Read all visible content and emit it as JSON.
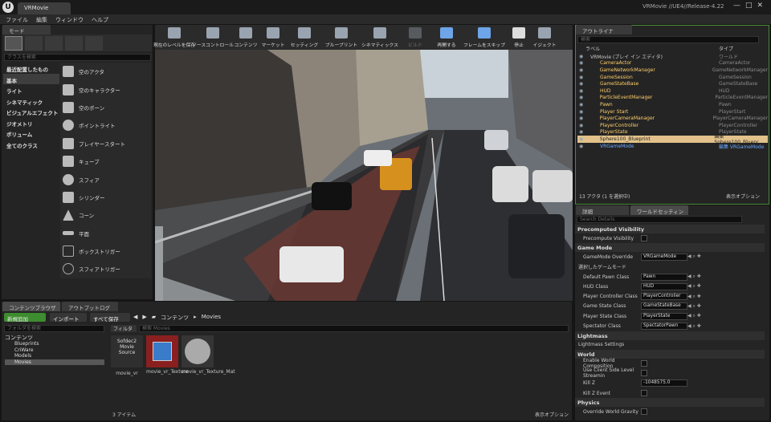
{
  "app": {
    "doc_tab": "VRMovie",
    "project": "VRMovie //UE4//Release-4.22",
    "window_buttons": [
      "—",
      "□",
      "✕"
    ]
  },
  "menu": [
    "ファイル",
    "編集",
    "ウィンドウ",
    "ヘルプ"
  ],
  "modes": {
    "tab": "モード",
    "search_placeholder": "クラスを検索",
    "categories": [
      "最近配置したもの",
      "基本",
      "ライト",
      "シネマティック",
      "ビジュアルエフェクト",
      "ジオメトリ",
      "ボリューム",
      "全てのクラス"
    ],
    "selected_category": 1,
    "items": [
      "空のアクタ",
      "空のキャラクター",
      "空のポーン",
      "ポイントライト",
      "プレイヤースタート",
      "キューブ",
      "スフィア",
      "シリンダー",
      "コーン",
      "平面",
      "ボックストリガー",
      "スフィアトリガー"
    ]
  },
  "toolbar": [
    "現在のレベルを保存",
    "ソースコントロール",
    "コンテンツ",
    "マーケット",
    "セッティング",
    "ブループリント",
    "シネマティックス",
    "ビルド",
    "再開する",
    "フレームをスキップ",
    "停止",
    "イジェクト"
  ],
  "outliner": {
    "tab": "アウトライナ",
    "search_placeholder": "検索",
    "col_label": "ラベル",
    "col_type": "タイプ",
    "rows": [
      {
        "name": "VRMovie (プレイ イン エディタ)",
        "type": "ワールド"
      },
      {
        "name": "CameraActor",
        "type": "CameraActor"
      },
      {
        "name": "GameNetworkManager",
        "type": "GameNetworkManager"
      },
      {
        "name": "GameSession",
        "type": "GameSession"
      },
      {
        "name": "GameStateBase",
        "type": "GameStateBase"
      },
      {
        "name": "HUD",
        "type": "HUD"
      },
      {
        "name": "ParticleEventManager",
        "type": "ParticleEventManager"
      },
      {
        "name": "Pawn",
        "type": "Pawn"
      },
      {
        "name": "Player Start",
        "type": "PlayerStart"
      },
      {
        "name": "PlayerCameraManager",
        "type": "PlayerCameraManager"
      },
      {
        "name": "PlayerController",
        "type": "PlayerController"
      },
      {
        "name": "PlayerState",
        "type": "PlayerState"
      },
      {
        "name": "Sphere100_Blueprint",
        "type": "編集 Sphere100_Bluepr"
      },
      {
        "name": "VRGameMode",
        "type": "編集 VRGameMode"
      }
    ],
    "selected_row": 12,
    "footer": "13 アクタ (1 を選択中)",
    "view_options": "表示オプション"
  },
  "details": {
    "tabs": [
      "詳細",
      "ワールドセッティング"
    ],
    "search_placeholder": "Search Details",
    "sections": [
      {
        "title": "Precomputed Visibility",
        "rows": [
          {
            "label": "Precompute Visibility",
            "kind": "check"
          }
        ]
      },
      {
        "title": "Game Mode",
        "rows": [
          {
            "label": "GameMode Override",
            "kind": "dd",
            "value": "VRGameMode"
          },
          {
            "label": "選択したゲームモード",
            "kind": "head"
          },
          {
            "label": "Default Pawn Class",
            "kind": "dd",
            "value": "Pawn"
          },
          {
            "label": "HUD Class",
            "kind": "dd",
            "value": "HUD"
          },
          {
            "label": "Player Controller Class",
            "kind": "dd",
            "value": "PlayerController"
          },
          {
            "label": "Game State Class",
            "kind": "dd",
            "value": "GameStateBase"
          },
          {
            "label": "Player State Class",
            "kind": "dd",
            "value": "PlayerState"
          },
          {
            "label": "Spectator Class",
            "kind": "dd",
            "value": "SpectatorPawn"
          }
        ]
      },
      {
        "title": "Lightmass",
        "rows": [
          {
            "label": "Lightmass Settings",
            "kind": "head"
          }
        ]
      },
      {
        "title": "World",
        "rows": [
          {
            "label": "Enable World Composition",
            "kind": "check"
          },
          {
            "label": "Use Client Side Level Streamin",
            "kind": "check"
          },
          {
            "label": "Kill Z",
            "kind": "num",
            "value": "-1048575.0"
          },
          {
            "label": "Kill Z Event",
            "kind": "check"
          }
        ]
      },
      {
        "title": "Physics",
        "rows": [
          {
            "label": "Override World Gravity",
            "kind": "check"
          }
        ]
      }
    ]
  },
  "content": {
    "tabs": [
      "コンテンツブラウザ",
      "アウトプットログ"
    ],
    "add_new": "新規追加",
    "import": "インポート",
    "save_all": "すべて保存",
    "breadcrumb": [
      "コンテンツ",
      "Movies"
    ],
    "folder_search_placeholder": "フォルダを検索",
    "tree": [
      "コンテンツ",
      "Blueprints",
      "CriWare",
      "Models",
      "Movies"
    ],
    "filter": "フィルタ",
    "asset_search_placeholder": "検索 Movies",
    "assets": [
      {
        "thumb": "Sofdec2 Movie Source",
        "name": "movie_vr"
      },
      {
        "thumb": "",
        "name": "movie_vr_Texture"
      },
      {
        "thumb": "",
        "name": "movie_vr_Texture_Mat"
      }
    ],
    "count": "3 アイテム",
    "view_options": "表示オプション"
  }
}
